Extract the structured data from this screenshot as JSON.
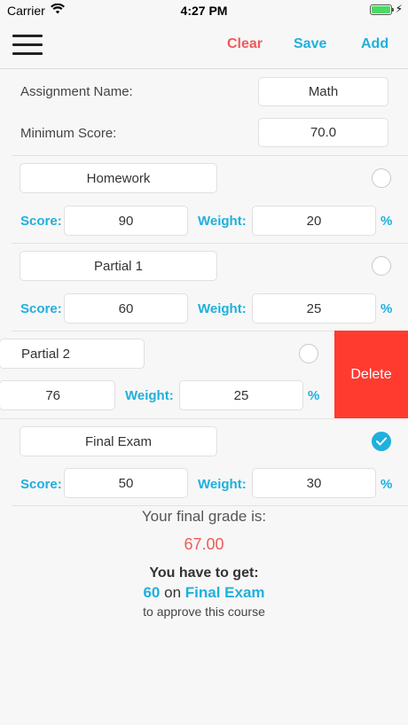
{
  "status": {
    "carrier": "Carrier",
    "time": "4:27 PM"
  },
  "nav": {
    "clear": "Clear",
    "save": "Save",
    "add": "Add"
  },
  "assignment": {
    "name_label": "Assignment Name:",
    "name_value": "Math",
    "min_label": "Minimum Score:",
    "min_value": "70.0"
  },
  "labels": {
    "score": "Score:",
    "weight": "Weight:",
    "percent": "%"
  },
  "items": [
    {
      "name": "Homework",
      "score": "90",
      "weight": "20",
      "selected": false
    },
    {
      "name": "Partial 1",
      "score": "60",
      "weight": "25",
      "selected": false
    },
    {
      "name": "Partial 2",
      "score": "76",
      "weight": "25",
      "selected": false
    },
    {
      "name": "Final Exam",
      "score": "50",
      "weight": "30",
      "selected": true
    }
  ],
  "delete_label": "Delete",
  "result": {
    "title": "Your final grade is:",
    "grade": "67.00",
    "need_title": "You have to get:",
    "need_score": "60",
    "need_on": "on",
    "need_item": "Final Exam",
    "approve": "to approve this course"
  },
  "colors": {
    "accent": "#1fb0dc",
    "danger": "#ef5a5a",
    "delete": "#ff3b30"
  }
}
